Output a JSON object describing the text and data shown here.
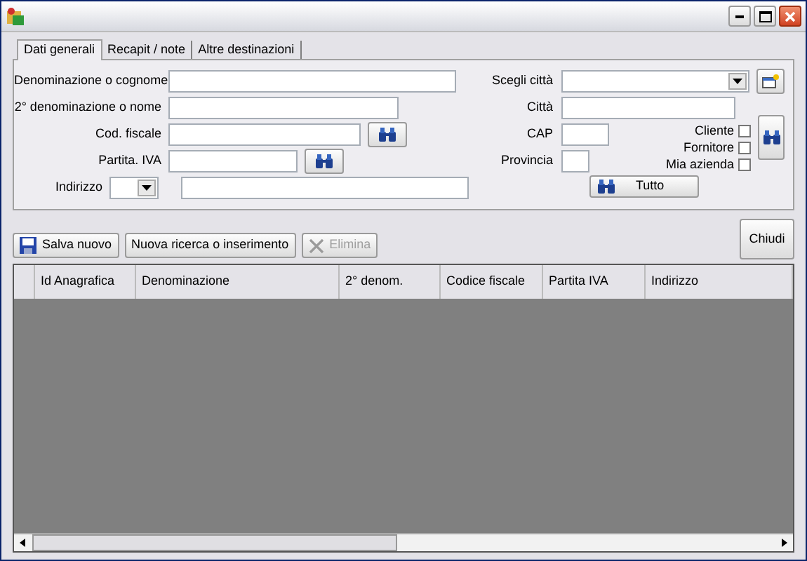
{
  "tabs": [
    {
      "label": "Dati generali",
      "selected": true
    },
    {
      "label": "Recapit / note",
      "selected": false
    },
    {
      "label": "Altre destinazioni",
      "selected": false
    }
  ],
  "left_fields": [
    {
      "label": "Denominazione o cognome",
      "kind": "wide"
    },
    {
      "label": "2° denominazione o nome",
      "kind": "medium"
    },
    {
      "label": "Cod. fiscale",
      "kind": "search"
    },
    {
      "label": "Partita. IVA",
      "kind": "search_short"
    },
    {
      "label": "Indirizzo",
      "kind": "address"
    }
  ],
  "right_fields": [
    {
      "label": "Scegli città",
      "kind": "combo"
    },
    {
      "label": "Città",
      "kind": "text"
    },
    {
      "label": "CAP",
      "kind": "short"
    },
    {
      "label": "Provincia",
      "kind": "tiny"
    }
  ],
  "checkboxes": [
    {
      "label": "Cliente",
      "checked": false
    },
    {
      "label": "Fornitore",
      "checked": false
    },
    {
      "label": "Mia azienda",
      "checked": false
    }
  ],
  "all_button": "Tutto",
  "toolbar": [
    {
      "label": "Salva nuovo",
      "kind": "save",
      "disabled": false
    },
    {
      "label": "Nuova ricerca o inserimento",
      "kind": "plain",
      "disabled": false
    },
    {
      "label": "Elimina",
      "kind": "delete",
      "disabled": true
    }
  ],
  "close_button": "Chiudi",
  "table": {
    "columns": [
      "Id Anagrafica",
      "Denominazione",
      "2° denom.",
      "Codice fiscale",
      "Partita IVA",
      "Indirizzo"
    ]
  }
}
